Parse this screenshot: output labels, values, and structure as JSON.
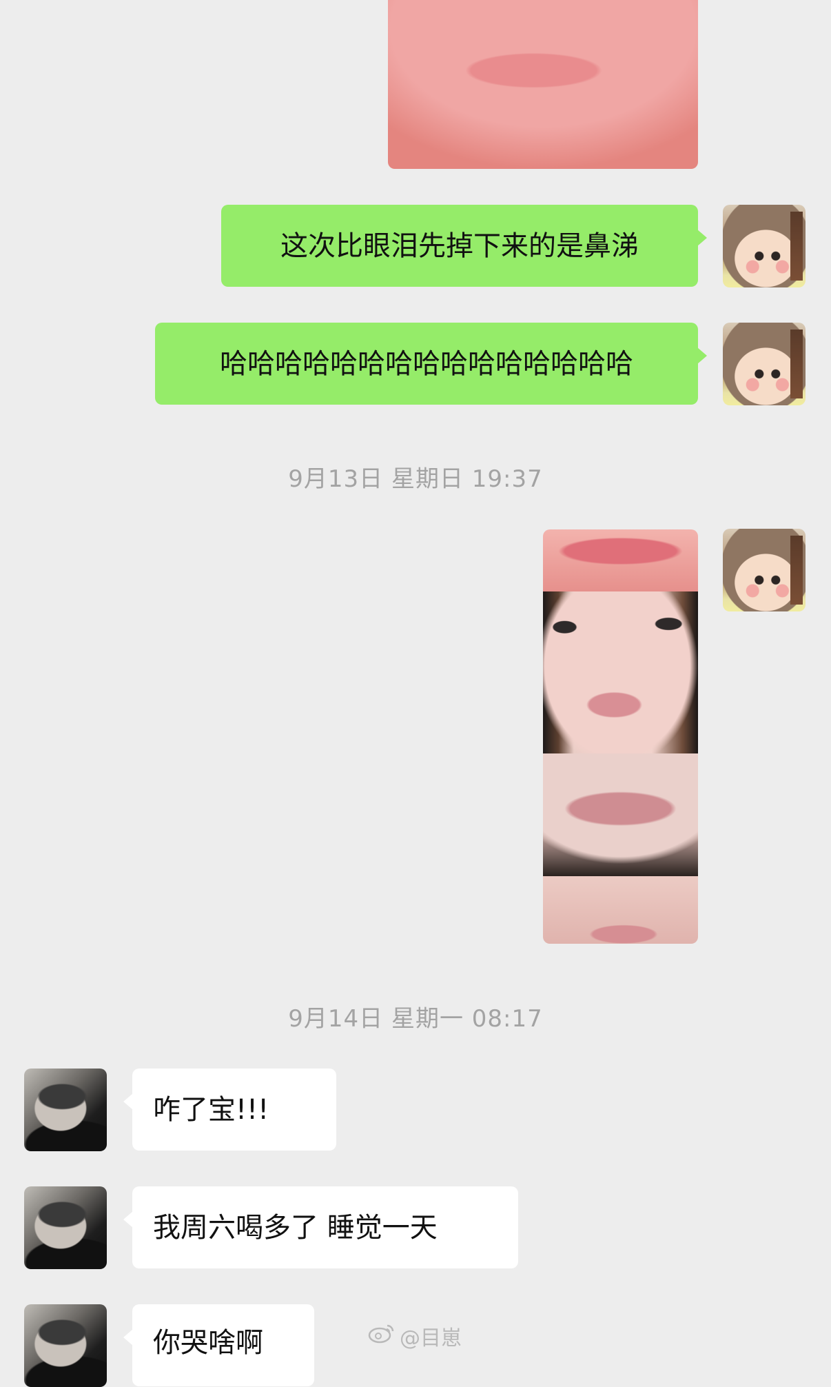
{
  "chat": {
    "messages": [
      {
        "id": "m1",
        "side": "right",
        "type": "text",
        "text": "这次比眼泪先掉下来的是鼻涕"
      },
      {
        "id": "m2",
        "side": "right",
        "type": "text",
        "text": "哈哈哈哈哈哈哈哈哈哈哈哈哈哈哈"
      },
      {
        "id": "m3",
        "side": "left",
        "type": "text",
        "text": "咋了宝!!!"
      },
      {
        "id": "m4",
        "side": "left",
        "type": "text",
        "text": "我周六喝多了 睡觉一天"
      },
      {
        "id": "m5",
        "side": "left",
        "type": "text",
        "text": "你哭啥啊"
      }
    ],
    "timestamps": {
      "t1": "9月13日 星期日 19:37",
      "t2": "9月14日 星期一 08:17"
    }
  },
  "watermark": {
    "text": "@目崽",
    "icon": "weibo-icon"
  },
  "colors": {
    "background": "#ededed",
    "sent_bubble": "#95ec69",
    "received_bubble": "#ffffff",
    "timestamp": "#a3a3a3"
  }
}
